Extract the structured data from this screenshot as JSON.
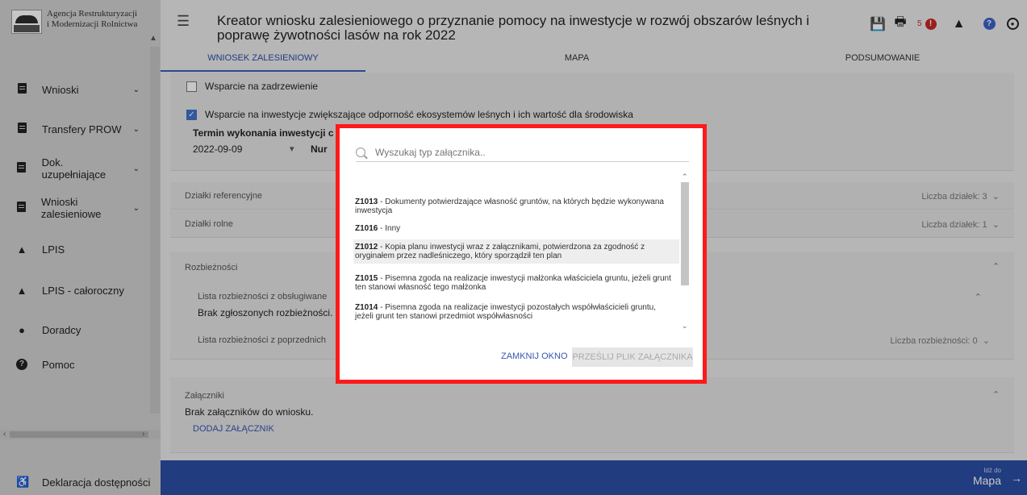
{
  "sidebar": {
    "logo_line1": "Agencja Restrukturyzacji",
    "logo_line2": "i Modernizacji Rolnictwa",
    "items": [
      {
        "label": "Wnioski",
        "icon": "document-icon"
      },
      {
        "label": "Transfery PROW",
        "icon": "document-icon"
      },
      {
        "label": "Dok. uzupełniające",
        "icon": "document-icon"
      },
      {
        "label": "Wnioski zalesieniowe",
        "icon": "document-icon"
      },
      {
        "label": "LPIS",
        "icon": "mountain-icon"
      },
      {
        "label": "LPIS - całoroczny",
        "icon": "mountain-icon"
      },
      {
        "label": "Doradcy",
        "icon": "person-icon"
      },
      {
        "label": "Pomoc",
        "icon": "help-icon"
      }
    ],
    "footer_label": "Deklaracja dostępności"
  },
  "header": {
    "title": "Kreator wniosku zalesieniowego o przyznanie pomocy na inwestycje w rozwój obszarów leśnych i poprawę żywotności lasów na rok 2022",
    "notification_count": "5"
  },
  "tabs": [
    "WNIOSEK ZALESIENIOWY",
    "MAPA",
    "PODSUMOWANIE"
  ],
  "form": {
    "cb1": "Wsparcie na zadrzewienie",
    "cb2": "Wsparcie na inwestycje zwiększające odporność ekosystemów leśnych i ich wartość dla środowiska",
    "termin_label": "Termin wykonania inwestycji c",
    "termin_value": "2022-09-09",
    "nu_label": "Nur"
  },
  "sections": {
    "dzialki_ref": "Działki referencyjne",
    "dzialki_ref_count": "Liczba działek: 3",
    "dzialki_rolne": "Działki rolne",
    "dzialki_rolne_count": "Liczba działek: 1",
    "rozbieznosci": "Rozbieżności",
    "lista1": "Lista rozbieżności z obsługiwane",
    "brak_rozb": "Brak zgłoszonych rozbieżności.",
    "lista2": "Lista rozbieżności z poprzednich",
    "rozb_count": "Liczba rozbieżności: 0",
    "zalaczniki": "Załączniki",
    "brak_zal": "Brak załączników do wniosku.",
    "dodaj": "DODAJ ZAŁĄCZNIK"
  },
  "footer": {
    "goto_small": "Idź do",
    "goto": "Mapa"
  },
  "modal": {
    "search_placeholder": "Wyszukaj typ załącznika..",
    "items": [
      {
        "code": "Z1013",
        "text": " - Dokumenty potwierdzające własność gruntów, na których będzie wykonywana inwestycja"
      },
      {
        "code": "Z1016",
        "text": " - Inny"
      },
      {
        "code": "Z1012",
        "text": " - Kopia planu inwestycji wraz z załącznikami, potwierdzona za zgodność z oryginałem przez nadleśniczego, który sporządził ten plan"
      },
      {
        "code": "Z1015",
        "text": " - Pisemna zgoda na realizacje inwestycji małżonka właściciela gruntu, jeżeli grunt ten stanowi własność tego małżonka"
      },
      {
        "code": "Z1014",
        "text": " - Pisemna zgoda na realizacje inwestycji pozostałych współwłaścicieli gruntu, jeżeli grunt ten stanowi przedmiot współwłasności"
      }
    ],
    "close_label": "ZAMKNIJ OKNO",
    "send_label": "PRZEŚLIJ PLIK ZAŁĄCZNIKA"
  }
}
